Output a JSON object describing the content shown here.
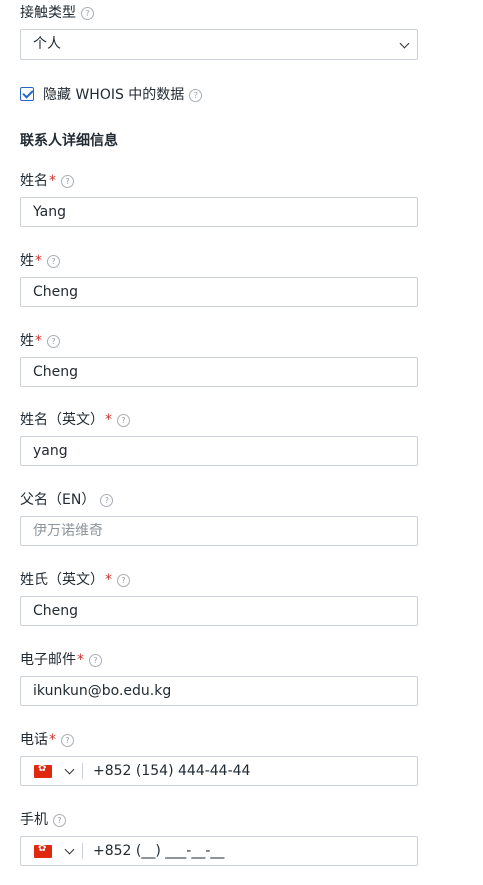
{
  "contact_type": {
    "label": "接触类型",
    "value": "个人"
  },
  "hide_whois": {
    "label": "隐藏 WHOIS 中的数据",
    "checked": true
  },
  "section_title": "联系人详细信息",
  "help_glyph": "?",
  "required_mark": "*",
  "fields": [
    {
      "label": "姓名",
      "value": "Yang"
    },
    {
      "label": "姓",
      "value": "Cheng"
    },
    {
      "label": "姓",
      "value": "Cheng"
    },
    {
      "label": "姓名（英文）",
      "value": "yang"
    },
    {
      "label": "父名（EN）",
      "placeholder": "伊万诺维奇"
    },
    {
      "label": "姓氏（英文）",
      "value": "Cheng"
    },
    {
      "label": "电子邮件",
      "value": "ikunkun@bo.edu.kg"
    }
  ],
  "phone": {
    "label": "电话",
    "value": "+852 (154) 444-44-44",
    "flag": "hong-kong-flag-icon"
  },
  "mobile": {
    "label": "手机",
    "value": "+852 (__) ___-__-__",
    "flag": "hong-kong-flag-icon"
  }
}
